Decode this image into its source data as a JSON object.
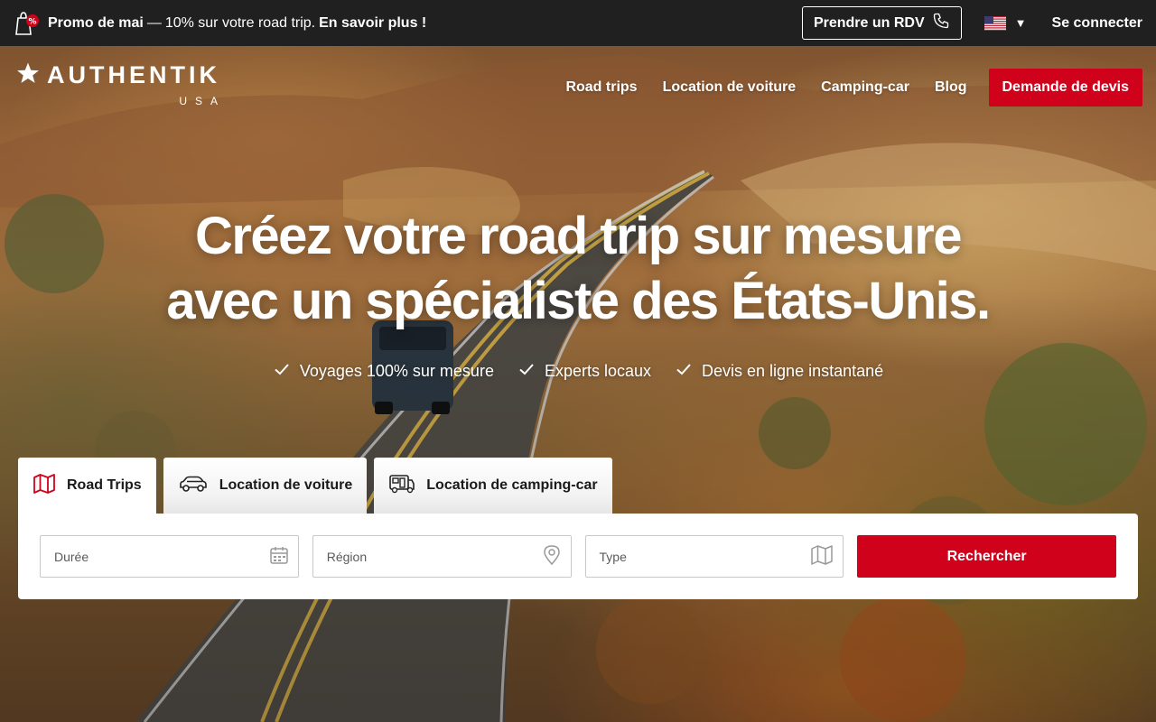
{
  "promo": {
    "title": "Promo de mai",
    "separator": "—",
    "text": "10% sur votre road trip.",
    "link": "En savoir plus !"
  },
  "topbar": {
    "rdv_label": "Prendre un RDV",
    "login_label": "Se connecter",
    "language_flag": "us-flag-icon"
  },
  "logo": {
    "name": "AUTHENTIK",
    "sub": "USA"
  },
  "nav": {
    "items": [
      {
        "label": "Road trips"
      },
      {
        "label": "Location de voiture"
      },
      {
        "label": "Camping-car"
      },
      {
        "label": "Blog"
      }
    ],
    "cta": "Demande de devis"
  },
  "hero": {
    "title_line1": "Créez votre road trip sur mesure",
    "title_line2": "avec un spécialiste des États-Unis.",
    "features": [
      {
        "label": "Voyages 100% sur mesure"
      },
      {
        "label": "Experts locaux"
      },
      {
        "label": "Devis en ligne instantané"
      }
    ]
  },
  "search": {
    "tabs": [
      {
        "label": "Road Trips",
        "icon": "map-icon",
        "active": true
      },
      {
        "label": "Location de voiture",
        "icon": "car-icon",
        "active": false
      },
      {
        "label": "Location de camping-car",
        "icon": "camper-icon",
        "active": false
      }
    ],
    "fields": [
      {
        "label": "Durée",
        "icon": "calendar-icon"
      },
      {
        "label": "Région",
        "icon": "location-pin-icon"
      },
      {
        "label": "Type",
        "icon": "map-icon"
      }
    ],
    "button": "Rechercher"
  },
  "colors": {
    "accent": "#d0021b",
    "topbar": "#202020"
  }
}
